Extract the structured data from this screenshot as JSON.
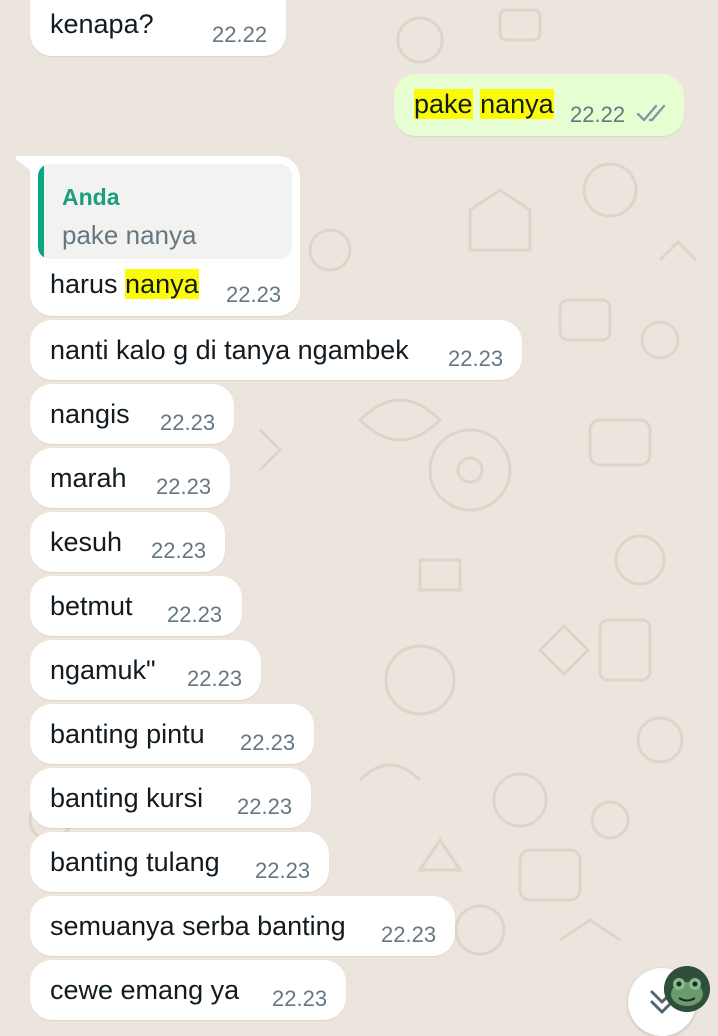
{
  "chat": {
    "messages": [
      {
        "text": "kenapa?",
        "time": "22.22"
      },
      {
        "text_before": "",
        "highlight1": "pake",
        "middle": " ",
        "highlight2": "nanya",
        "time": "22.22",
        "status": "read-ticks"
      },
      {
        "quote_author": "Anda",
        "quote_text": "pake nanya",
        "text_before": "harus ",
        "highlight": "nanya",
        "time": "22.23"
      },
      {
        "text": "nanti kalo g di tanya ngambek",
        "time": "22.23"
      },
      {
        "text": "nangis",
        "time": "22.23"
      },
      {
        "text": "marah",
        "time": "22.23"
      },
      {
        "text": "kesuh",
        "time": "22.23"
      },
      {
        "text": "betmut",
        "time": "22.23"
      },
      {
        "text": "ngamuk\"",
        "time": "22.23"
      },
      {
        "text": "banting pintu",
        "time": "22.23"
      },
      {
        "text": "banting kursi",
        "time": "22.23"
      },
      {
        "text": "banting tulang",
        "time": "22.23"
      },
      {
        "text": "semuanya serba banting",
        "time": "22.23"
      },
      {
        "text": "cewe emang ya",
        "time": "22.23"
      }
    ]
  },
  "icons": {
    "read_ticks": "double-check-icon",
    "scroll_down": "chevron-double-down-icon",
    "avatar": "frog-avatar"
  },
  "colors": {
    "background": "#ece5dd",
    "incoming_bubble": "#ffffff",
    "outgoing_bubble": "#e7fed3",
    "highlight": "#fbfb06",
    "quote_accent": "#06a884",
    "timestamp": "#667781"
  }
}
